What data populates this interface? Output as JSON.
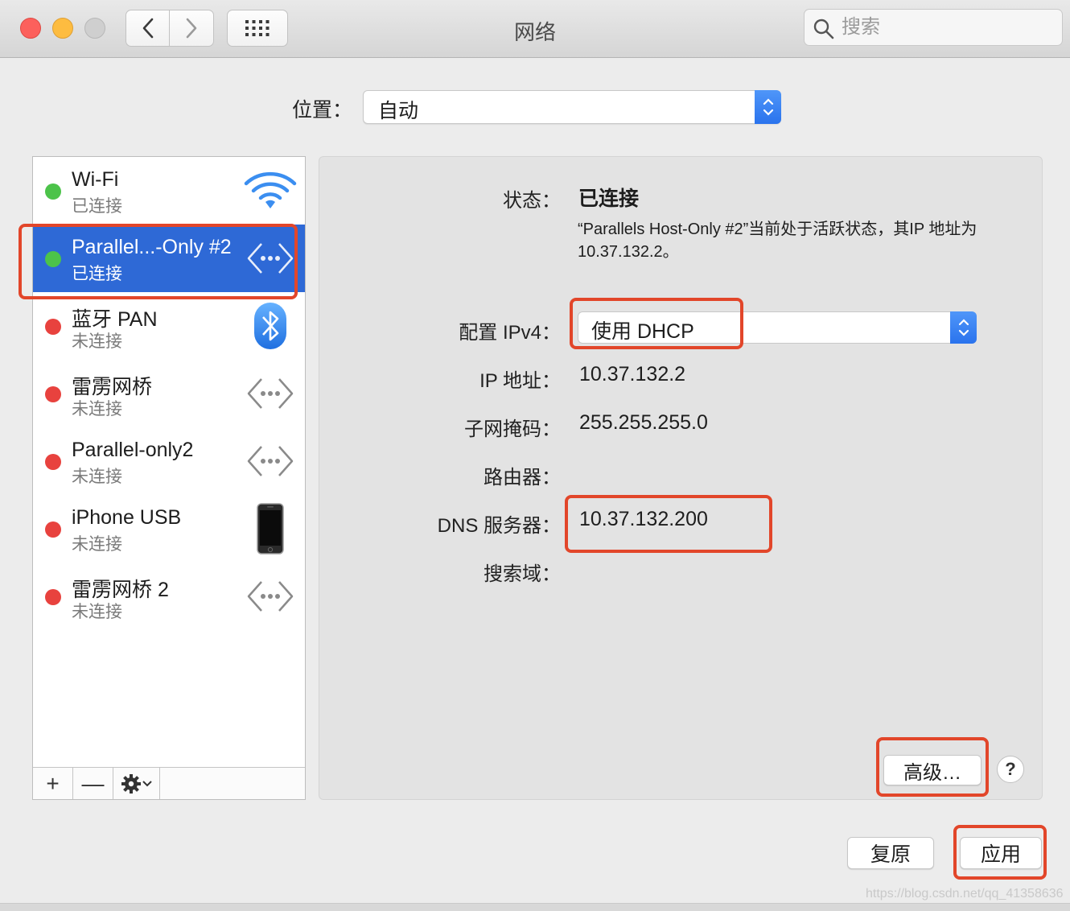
{
  "window": {
    "title": "网络",
    "search_placeholder": "搜索"
  },
  "location": {
    "label": "位置：",
    "value": "自动"
  },
  "services": [
    {
      "name": "Wi-Fi",
      "status": "已连接",
      "connected": true,
      "icon": "wifi-icon"
    },
    {
      "name": "Parallel...-Only #2",
      "status": "已连接",
      "connected": true,
      "icon": "ethernet-arrows-icon",
      "selected": true
    },
    {
      "name": "蓝牙 PAN",
      "status": "未连接",
      "connected": false,
      "icon": "bluetooth-icon"
    },
    {
      "name": "雷雳网桥",
      "status": "未连接",
      "connected": false,
      "icon": "ethernet-arrows-icon"
    },
    {
      "name": "Parallel-only2",
      "status": "未连接",
      "connected": false,
      "icon": "ethernet-arrows-icon"
    },
    {
      "name": "iPhone USB",
      "status": "未连接",
      "connected": false,
      "icon": "iphone-icon"
    },
    {
      "name": "雷雳网桥 2",
      "status": "未连接",
      "connected": false,
      "icon": "ethernet-arrows-icon"
    }
  ],
  "sidebar_toolbar": {
    "add": "+",
    "remove": "—"
  },
  "details": {
    "status_label": "状态：",
    "status_value": "已连接",
    "status_desc": "“Parallels Host-Only #2”当前处于活跃状态，其IP 地址为 10.37.132.2。",
    "ipv4_label": "配置 IPv4：",
    "ipv4_value": "使用 DHCP",
    "ip_label": "IP 地址：",
    "ip_value": "10.37.132.2",
    "subnet_label": "子网掩码：",
    "subnet_value": "255.255.255.0",
    "router_label": "路由器：",
    "router_value": "",
    "dns_label": "DNS 服务器：",
    "dns_value": "10.37.132.200",
    "search_domain_label": "搜索域：",
    "search_domain_value": "",
    "advanced_button": "高级…",
    "help_button": "?"
  },
  "footer": {
    "revert_button": "复原",
    "apply_button": "应用"
  },
  "watermark": "https://blog.csdn.net/qq_41358636",
  "colors": {
    "accent_blue": "#2e69d6",
    "highlight_red": "#e2462a",
    "connected_green": "#4cc34a",
    "disconnected_red": "#e8423e"
  }
}
